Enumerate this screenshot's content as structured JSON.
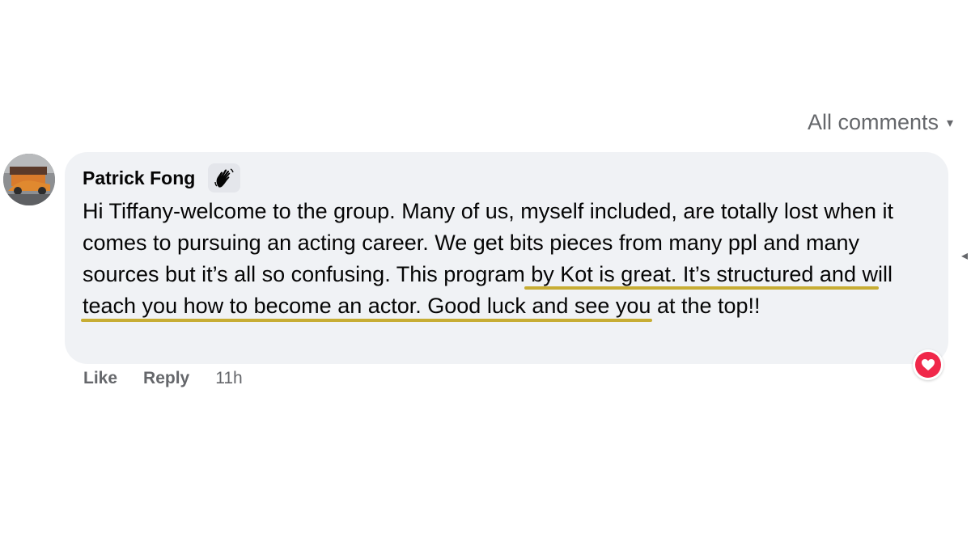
{
  "header": {
    "all_comments_label": "All comments"
  },
  "comment": {
    "author": "Patrick Fong",
    "text_parts": [
      "Hi Tiffany-welcome to the group. Many of us, myself included, are totally lost when it comes to pursuing an acting career. We get bits pieces from many ppl and many sources but it’s all so confusing.",
      " This program by Kot is great. It’s structured and will teach you how to become an actor.",
      " Good luck and see you at the top!!"
    ],
    "badge_icon": "waving-hand-icon",
    "reaction_icon": "heart-icon",
    "actions": {
      "like": "Like",
      "reply": "Reply",
      "time": "11h"
    }
  },
  "colors": {
    "bubble_bg": "#f0f2f5",
    "underline": "#c7ad34",
    "reaction": "#f0284a",
    "secondary_text": "#65676b"
  }
}
